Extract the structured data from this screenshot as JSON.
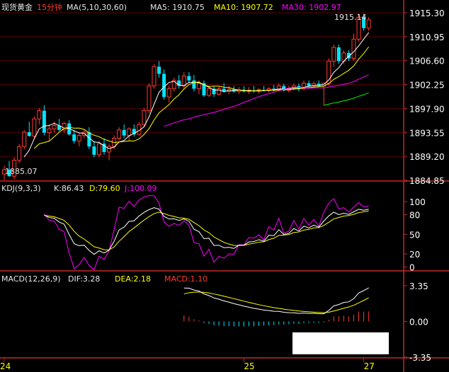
{
  "colors": {
    "background": "#000000",
    "frame": "#c62828",
    "grid": "#5a0000",
    "up": "#ff3b30",
    "down": "#00e5ff",
    "ma5": "#ffffff",
    "ma10": "#ffff00",
    "ma30": "#ff00ff",
    "ma60": "#00ff00",
    "dif": "#ffffff",
    "dea": "#ffff00",
    "macd_pos": "#ff3b30",
    "macd_neg": "#00e5ff",
    "text": "#e6e6e6"
  },
  "header": {
    "instrument": "现货黄金",
    "period": "15分钟",
    "ma_label": "MA(5,10,30,60)",
    "ma5_text": "MA5: 1910.75",
    "ma10_text": "MA10: 1907.72",
    "ma30_text": "MA30: 1902.97"
  },
  "kdj_header": {
    "name": "KDJ(9,3,3)",
    "k_text": "K:86.43",
    "d_text": "D:79.60",
    "j_text": "J:100.09"
  },
  "macd_header": {
    "name": "MACD(12,26,9)",
    "dif_text": "DIF:3.28",
    "dea_text": "DEA:2.18",
    "macd_text": "MACD:1.10"
  },
  "annotations": {
    "high_label": "1915.14",
    "low_label": "1885.07"
  },
  "chart_data": [
    {
      "type": "candlestick",
      "name": "price",
      "y_ticks": [
        1915.3,
        1910.95,
        1906.6,
        1902.25,
        1897.9,
        1893.55,
        1889.2,
        1884.85
      ],
      "y_tick_labels": [
        "1915.30",
        "1910.95",
        "1906.60",
        "1902.25",
        "1897.90",
        "1893.55",
        "1889.20",
        "1884.85"
      ],
      "ylim": [
        1884.85,
        1915.3
      ],
      "x_labels": [
        "24",
        "25",
        "27"
      ],
      "x_label_index": [
        0,
        48,
        72
      ],
      "candles": [
        [
          1886.0,
          1887.5,
          1884.9,
          1886.8
        ],
        [
          1886.8,
          1888.4,
          1885.5,
          1885.6
        ],
        [
          1885.6,
          1889.0,
          1885.07,
          1888.5
        ],
        [
          1888.5,
          1891.5,
          1888.0,
          1891.0
        ],
        [
          1891.0,
          1894.0,
          1890.5,
          1893.6
        ],
        [
          1893.6,
          1895.5,
          1892.8,
          1892.9
        ],
        [
          1892.9,
          1896.5,
          1892.5,
          1896.0
        ],
        [
          1896.0,
          1898.0,
          1895.0,
          1897.5
        ],
        [
          1897.5,
          1898.5,
          1893.0,
          1893.5
        ],
        [
          1893.5,
          1895.0,
          1892.0,
          1894.2
        ],
        [
          1894.2,
          1895.5,
          1893.5,
          1894.8
        ],
        [
          1894.8,
          1896.0,
          1893.8,
          1894.0
        ],
        [
          1894.0,
          1895.5,
          1893.5,
          1895.2
        ],
        [
          1895.2,
          1895.8,
          1893.0,
          1893.2
        ],
        [
          1893.2,
          1894.0,
          1891.5,
          1892.0
        ],
        [
          1892.0,
          1893.5,
          1891.0,
          1893.0
        ],
        [
          1893.0,
          1894.0,
          1892.5,
          1893.6
        ],
        [
          1893.6,
          1894.5,
          1890.5,
          1891.0
        ],
        [
          1891.0,
          1892.0,
          1889.0,
          1889.5
        ],
        [
          1889.5,
          1892.0,
          1889.0,
          1891.5
        ],
        [
          1891.5,
          1892.5,
          1889.5,
          1890.0
        ],
        [
          1890.0,
          1891.5,
          1888.5,
          1891.0
        ],
        [
          1891.0,
          1893.0,
          1890.5,
          1892.5
        ],
        [
          1892.5,
          1894.5,
          1892.0,
          1894.0
        ],
        [
          1894.0,
          1895.0,
          1892.5,
          1893.0
        ],
        [
          1893.0,
          1894.5,
          1892.0,
          1894.2
        ],
        [
          1894.2,
          1895.0,
          1892.8,
          1893.2
        ],
        [
          1893.2,
          1895.5,
          1893.0,
          1895.0
        ],
        [
          1895.0,
          1898.0,
          1894.5,
          1897.5
        ],
        [
          1897.5,
          1902.5,
          1897.0,
          1902.0
        ],
        [
          1902.0,
          1906.0,
          1901.5,
          1905.5
        ],
        [
          1905.5,
          1906.5,
          1903.5,
          1904.2
        ],
        [
          1904.2,
          1905.0,
          1899.5,
          1900.0
        ],
        [
          1900.0,
          1902.0,
          1899.0,
          1901.5
        ],
        [
          1901.5,
          1903.5,
          1901.0,
          1903.0
        ],
        [
          1903.0,
          1904.0,
          1901.5,
          1902.0
        ],
        [
          1902.0,
          1904.5,
          1901.5,
          1903.8
        ],
        [
          1903.8,
          1904.5,
          1902.5,
          1903.0
        ],
        [
          1903.0,
          1904.0,
          1901.0,
          1901.5
        ],
        [
          1901.5,
          1903.0,
          1900.5,
          1902.5
        ],
        [
          1902.5,
          1903.0,
          1900.0,
          1900.3
        ],
        [
          1900.3,
          1902.0,
          1900.0,
          1901.5
        ],
        [
          1901.5,
          1902.0,
          1900.0,
          1900.5
        ],
        [
          1900.5,
          1902.0,
          1900.2,
          1901.5
        ],
        [
          1901.5,
          1902.5,
          1900.8,
          1901.0
        ],
        [
          1901.0,
          1902.0,
          1900.5,
          1901.4
        ],
        [
          1901.4,
          1902.0,
          1900.8,
          1901.0
        ],
        [
          1901.0,
          1901.8,
          1900.5,
          1901.3
        ],
        [
          1901.3,
          1902.0,
          1900.8,
          1901.0
        ],
        [
          1901.0,
          1901.8,
          1900.5,
          1901.2
        ],
        [
          1901.2,
          1902.0,
          1900.8,
          1901.0
        ],
        [
          1901.0,
          1901.6,
          1900.6,
          1901.3
        ],
        [
          1901.3,
          1902.0,
          1901.0,
          1901.2
        ],
        [
          1901.2,
          1901.8,
          1900.8,
          1901.5
        ],
        [
          1901.5,
          1902.2,
          1901.0,
          1901.3
        ],
        [
          1901.3,
          1902.5,
          1901.0,
          1902.0
        ],
        [
          1902.0,
          1902.4,
          1901.0,
          1901.2
        ],
        [
          1901.2,
          1902.0,
          1900.8,
          1901.6
        ],
        [
          1901.6,
          1902.5,
          1901.2,
          1902.0
        ],
        [
          1902.0,
          1902.5,
          1901.0,
          1901.5
        ],
        [
          1901.5,
          1903.0,
          1901.2,
          1902.5
        ],
        [
          1902.5,
          1903.0,
          1901.8,
          1902.0
        ],
        [
          1902.0,
          1902.8,
          1901.5,
          1902.4
        ],
        [
          1902.4,
          1903.0,
          1901.8,
          1902.0
        ],
        [
          1902.0,
          1902.5,
          1898.5,
          1902.5
        ],
        [
          1902.5,
          1907.0,
          1902.0,
          1906.5
        ],
        [
          1906.5,
          1909.5,
          1905.5,
          1909.0
        ],
        [
          1909.0,
          1909.5,
          1906.0,
          1906.5
        ],
        [
          1906.5,
          1908.5,
          1906.0,
          1908.0
        ],
        [
          1908.0,
          1908.5,
          1906.5,
          1907.0
        ],
        [
          1907.0,
          1911.5,
          1906.5,
          1910.5
        ],
        [
          1910.5,
          1915.14,
          1910.0,
          1914.5
        ],
        [
          1914.5,
          1915.14,
          1912.0,
          1912.5
        ],
        [
          1912.5,
          1914.5,
          1912.0,
          1914.0
        ]
      ],
      "ma5_end": 1910.75,
      "ma10_end": 1907.72,
      "ma30_end": 1902.97,
      "annotations": [
        {
          "text": "1915.14",
          "index": 70,
          "value": 1915.14
        },
        {
          "text": "1885.07",
          "index": 2,
          "value": 1885.07
        }
      ]
    },
    {
      "type": "line",
      "name": "KDJ(9,3,3)",
      "y_ticks": [
        100,
        80,
        50,
        20,
        0
      ],
      "y_tick_labels": [
        "100",
        "80",
        "50",
        "20",
        "0"
      ],
      "ylim": [
        -5,
        110
      ],
      "last_values": {
        "K": 86.43,
        "D": 79.6,
        "J": 100.09
      }
    },
    {
      "type": "bar+line",
      "name": "MACD(12,26,9)",
      "y_ticks": [
        3.35,
        0.0,
        -3.35
      ],
      "y_tick_labels": [
        "3.35",
        "0.00",
        "-3.35"
      ],
      "ylim": [
        -3.35,
        3.35
      ],
      "last_values": {
        "DIF": 3.28,
        "DEA": 2.18,
        "MACD": 1.1
      }
    }
  ]
}
